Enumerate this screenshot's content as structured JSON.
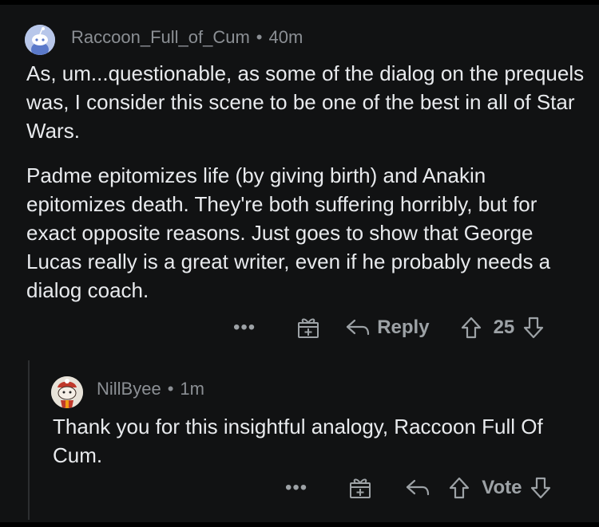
{
  "comments": [
    {
      "username": "Raccoon_Full_of_Cum",
      "separator": "•",
      "time": "40m",
      "paragraphs": [
        "As, um...questionable, as some of the dialog on the prequels was, I consider this scene to be one of the best in all of Star Wars.",
        "Padme epitomizes life (by giving birth) and Anakin epitomizes death. They're both suffering horribly, but for exact opposite reasons. Just goes to show that George Lucas really is a great writer, even if he probably needs a dialog coach."
      ],
      "actions": {
        "more": "•••",
        "reply": "Reply",
        "score": "25"
      }
    },
    {
      "username": "NillByee",
      "separator": "•",
      "time": "1m",
      "paragraphs": [
        "Thank you for this insightful analogy, Raccoon Full Of Cum."
      ],
      "actions": {
        "more": "•••",
        "vote": "Vote"
      }
    }
  ],
  "colors": {
    "background": "#111213",
    "text": "#e8eaed",
    "meta": "#8b8f94",
    "icons": "#9da2a6"
  },
  "icons": [
    "more-icon",
    "award-icon",
    "reply-icon",
    "upvote-icon",
    "downvote-icon"
  ]
}
